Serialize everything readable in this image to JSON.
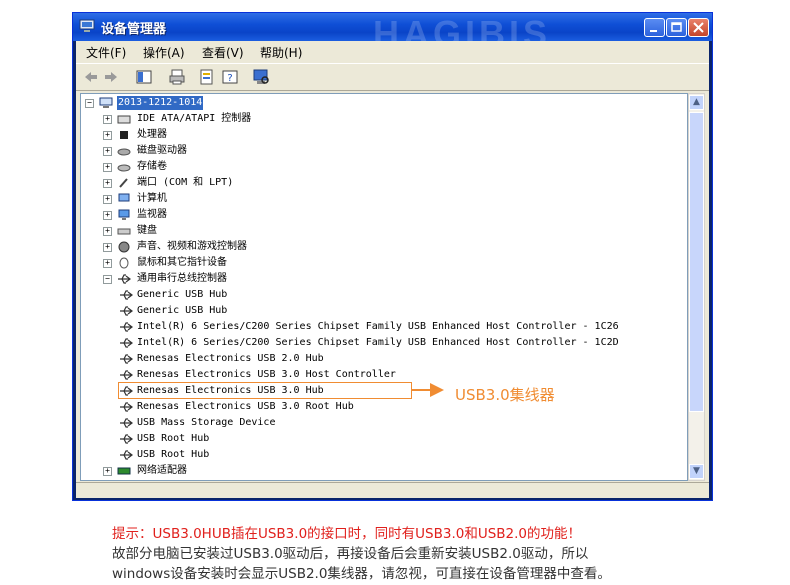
{
  "window": {
    "title": "设备管理器",
    "watermark": "HAGIBIS"
  },
  "menu": [
    "文件(F)",
    "操作(A)",
    "查看(V)",
    "帮助(H)"
  ],
  "tree": {
    "root": "2013-1212-1014",
    "categories": [
      "IDE ATA/ATAPI 控制器",
      "处理器",
      "磁盘驱动器",
      "存储卷",
      "端口 (COM 和 LPT)",
      "计算机",
      "监视器",
      "键盘",
      "声音、视频和游戏控制器",
      "鼠标和其它指针设备",
      "通用串行总线控制器"
    ],
    "usb_children": [
      "Generic USB Hub",
      "Generic USB Hub",
      "Intel(R) 6 Series/C200 Series Chipset Family USB Enhanced Host Controller - 1C26",
      "Intel(R) 6 Series/C200 Series Chipset Family USB Enhanced Host Controller - 1C2D",
      "Renesas Electronics USB 2.0 Hub",
      "Renesas Electronics USB 3.0 Host Controller",
      "Renesas Electronics USB 3.0 Hub",
      "Renesas Electronics USB 3.0 Root Hub",
      "USB Mass Storage Device",
      "USB Root Hub",
      "USB Root Hub"
    ],
    "last_category": "网络适配器"
  },
  "annotation": {
    "label": "USB3.0集线器"
  },
  "notes": {
    "line1": "提示：USB3.0HUB插在USB3.0的接口时，同时有USB3.0和USB2.0的功能！",
    "line2": "故部分电脑已安装过USB3.0驱动后，再接设备后会重新安装USB2.0驱动，所以",
    "line3": "windows设备安装时会显示USB2.0集线器，请忽视，可直接在设备管理器中查看。"
  },
  "colors": {
    "accent": "#f08c32",
    "tip_red": "#e0201c",
    "note_gray": "#333333"
  }
}
